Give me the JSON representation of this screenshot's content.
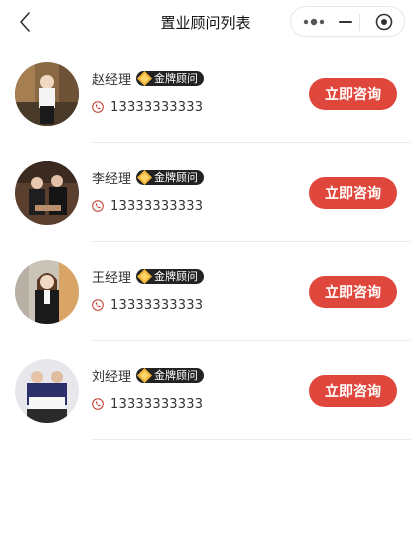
{
  "navbar": {
    "title": "置业顾问列表",
    "back_icon": "chevron-left-icon",
    "more_icon": "more-dots-icon",
    "minimize_icon": "minus-icon",
    "close_icon": "target-circle-icon"
  },
  "consultants": [
    {
      "name": "赵经理",
      "badge": "金牌顾问",
      "phone": "13333333333",
      "button": "立即咨询"
    },
    {
      "name": "李经理",
      "badge": "金牌顾问",
      "phone": "13333333333",
      "button": "立即咨询"
    },
    {
      "name": "王经理",
      "badge": "金牌顾问",
      "phone": "13333333333",
      "button": "立即咨询"
    },
    {
      "name": "刘经理",
      "badge": "金牌顾问",
      "phone": "13333333333",
      "button": "立即咨询"
    }
  ],
  "colors": {
    "accent": "#e0473c",
    "badge_bg": "#222222",
    "badge_gem": "#f0b43a"
  }
}
